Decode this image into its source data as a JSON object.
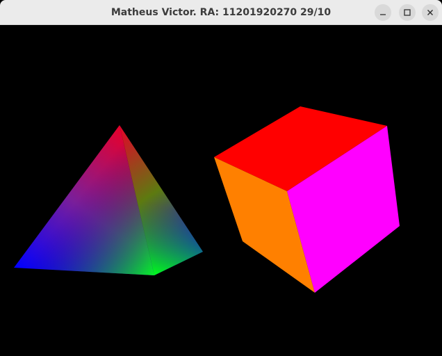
{
  "window": {
    "title": "Matheus Victor. RA: 11201920270 29/10",
    "controls": [
      "minimize-icon",
      "maximize-icon",
      "close-icon"
    ]
  },
  "scene": {
    "background": "#000000",
    "objects": [
      {
        "type": "pyramid",
        "colors": [
          "#ff0000",
          "#0000ff",
          "#00ff00",
          "#0000ff"
        ]
      },
      {
        "type": "cube",
        "colors": {
          "top": "#ff0000",
          "left": "#ff8000",
          "right": "#ff00ff"
        }
      }
    ]
  }
}
